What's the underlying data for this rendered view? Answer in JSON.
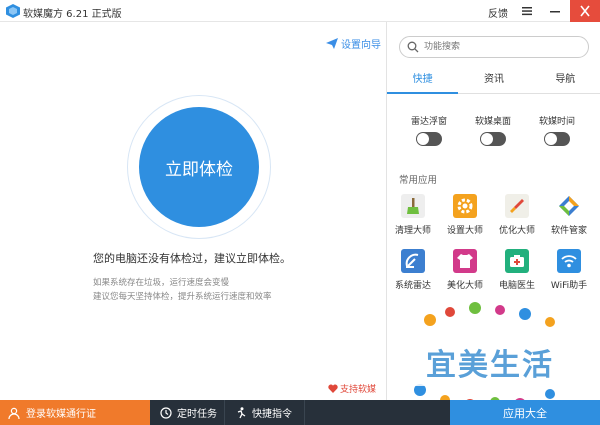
{
  "titlebar": {
    "title": "软媒魔方 6.21 正式版",
    "feedback": "反馈",
    "close_color": "#e64c3c"
  },
  "main": {
    "setup_guide": "设置向导",
    "check_button": "立即体检",
    "message_main": "您的电脑还没有体检过，建议立即体检。",
    "message_sub1": "如果系统存在垃圾，运行速度会变慢",
    "message_sub2": "建议您每天坚持体检，提升系统运行速度和效率",
    "support_link": "支持软媒"
  },
  "sidebar": {
    "search_placeholder": "功能搜索",
    "tabs": [
      {
        "label": "快捷",
        "active": true
      },
      {
        "label": "资讯",
        "active": false
      },
      {
        "label": "导航",
        "active": false
      }
    ],
    "toggles": [
      {
        "label": "雷达浮窗",
        "on": false
      },
      {
        "label": "软媒桌面",
        "on": false
      },
      {
        "label": "软媒时间",
        "on": false
      }
    ],
    "section_title": "常用应用",
    "apps": [
      {
        "label": "清理大师",
        "icon": "broom-icon",
        "color": "#eeeeee"
      },
      {
        "label": "设置大师",
        "icon": "gear-icon",
        "color": "#f4a21e"
      },
      {
        "label": "优化大师",
        "icon": "rocket-icon",
        "color": "#f0efe8"
      },
      {
        "label": "软件管家",
        "icon": "software-manager-icon",
        "color": "#ffffff"
      },
      {
        "label": "系统雷达",
        "icon": "radar-icon",
        "color": "#3c7fd0"
      },
      {
        "label": "美化大师",
        "icon": "tshirt-icon",
        "color": "#d23a8a"
      },
      {
        "label": "电脑医生",
        "icon": "medical-kit-icon",
        "color": "#22b07d"
      },
      {
        "label": "WiFi助手",
        "icon": "wifi-icon",
        "color": "#2f8fe0"
      }
    ]
  },
  "watermark": {
    "text": "宜美生活"
  },
  "bottombar": {
    "login": "登录软媒通行证",
    "timer": "定时任务",
    "quick_cmd": "快捷指令",
    "app_store": "应用大全",
    "login_color": "#f07a2b",
    "store_color": "#2f8fe0"
  }
}
